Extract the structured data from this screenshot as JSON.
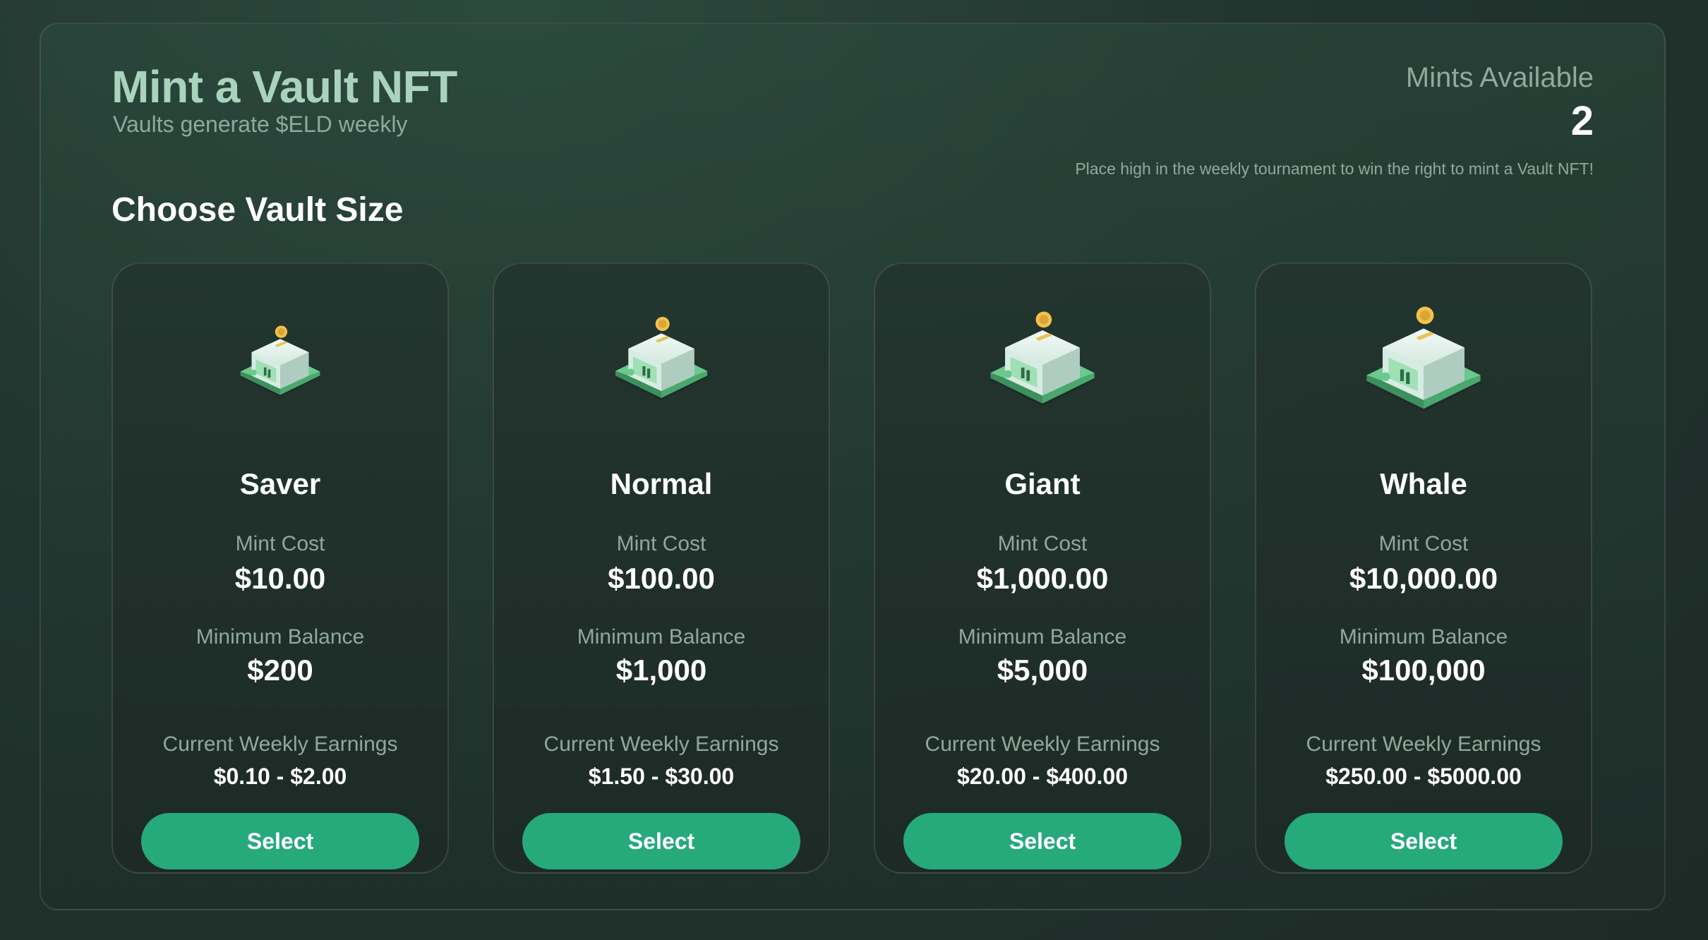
{
  "header": {
    "title": "Mint a Vault NFT",
    "subtitle": "Vaults generate $ELD weekly",
    "mints_label": "Mints Available",
    "mints_count": "2",
    "mints_note": "Place high in the weekly tournament to win the right to mint a Vault NFT!"
  },
  "section_title": "Choose Vault Size",
  "labels": {
    "mint_cost": "Mint Cost",
    "minimum_balance": "Minimum Balance",
    "weekly_earnings": "Current Weekly Earnings",
    "select": "Select"
  },
  "colors": {
    "accent": "#26a97b",
    "title": "#a9d3bd",
    "muted": "#8fa99b"
  },
  "vaults": [
    {
      "name": "Saver",
      "icon": "vault-safe-icon",
      "mint_cost": "$10.00",
      "minimum_balance": "$200",
      "weekly_earnings": "$0.10 - $2.00"
    },
    {
      "name": "Normal",
      "icon": "vault-safe-icon",
      "mint_cost": "$100.00",
      "minimum_balance": "$1,000",
      "weekly_earnings": "$1.50 - $30.00"
    },
    {
      "name": "Giant",
      "icon": "vault-safe-icon",
      "mint_cost": "$1,000.00",
      "minimum_balance": "$5,000",
      "weekly_earnings": "$20.00 - $400.00"
    },
    {
      "name": "Whale",
      "icon": "vault-safe-icon",
      "mint_cost": "$10,000.00",
      "minimum_balance": "$100,000",
      "weekly_earnings": "$250.00 - $5000.00"
    }
  ]
}
